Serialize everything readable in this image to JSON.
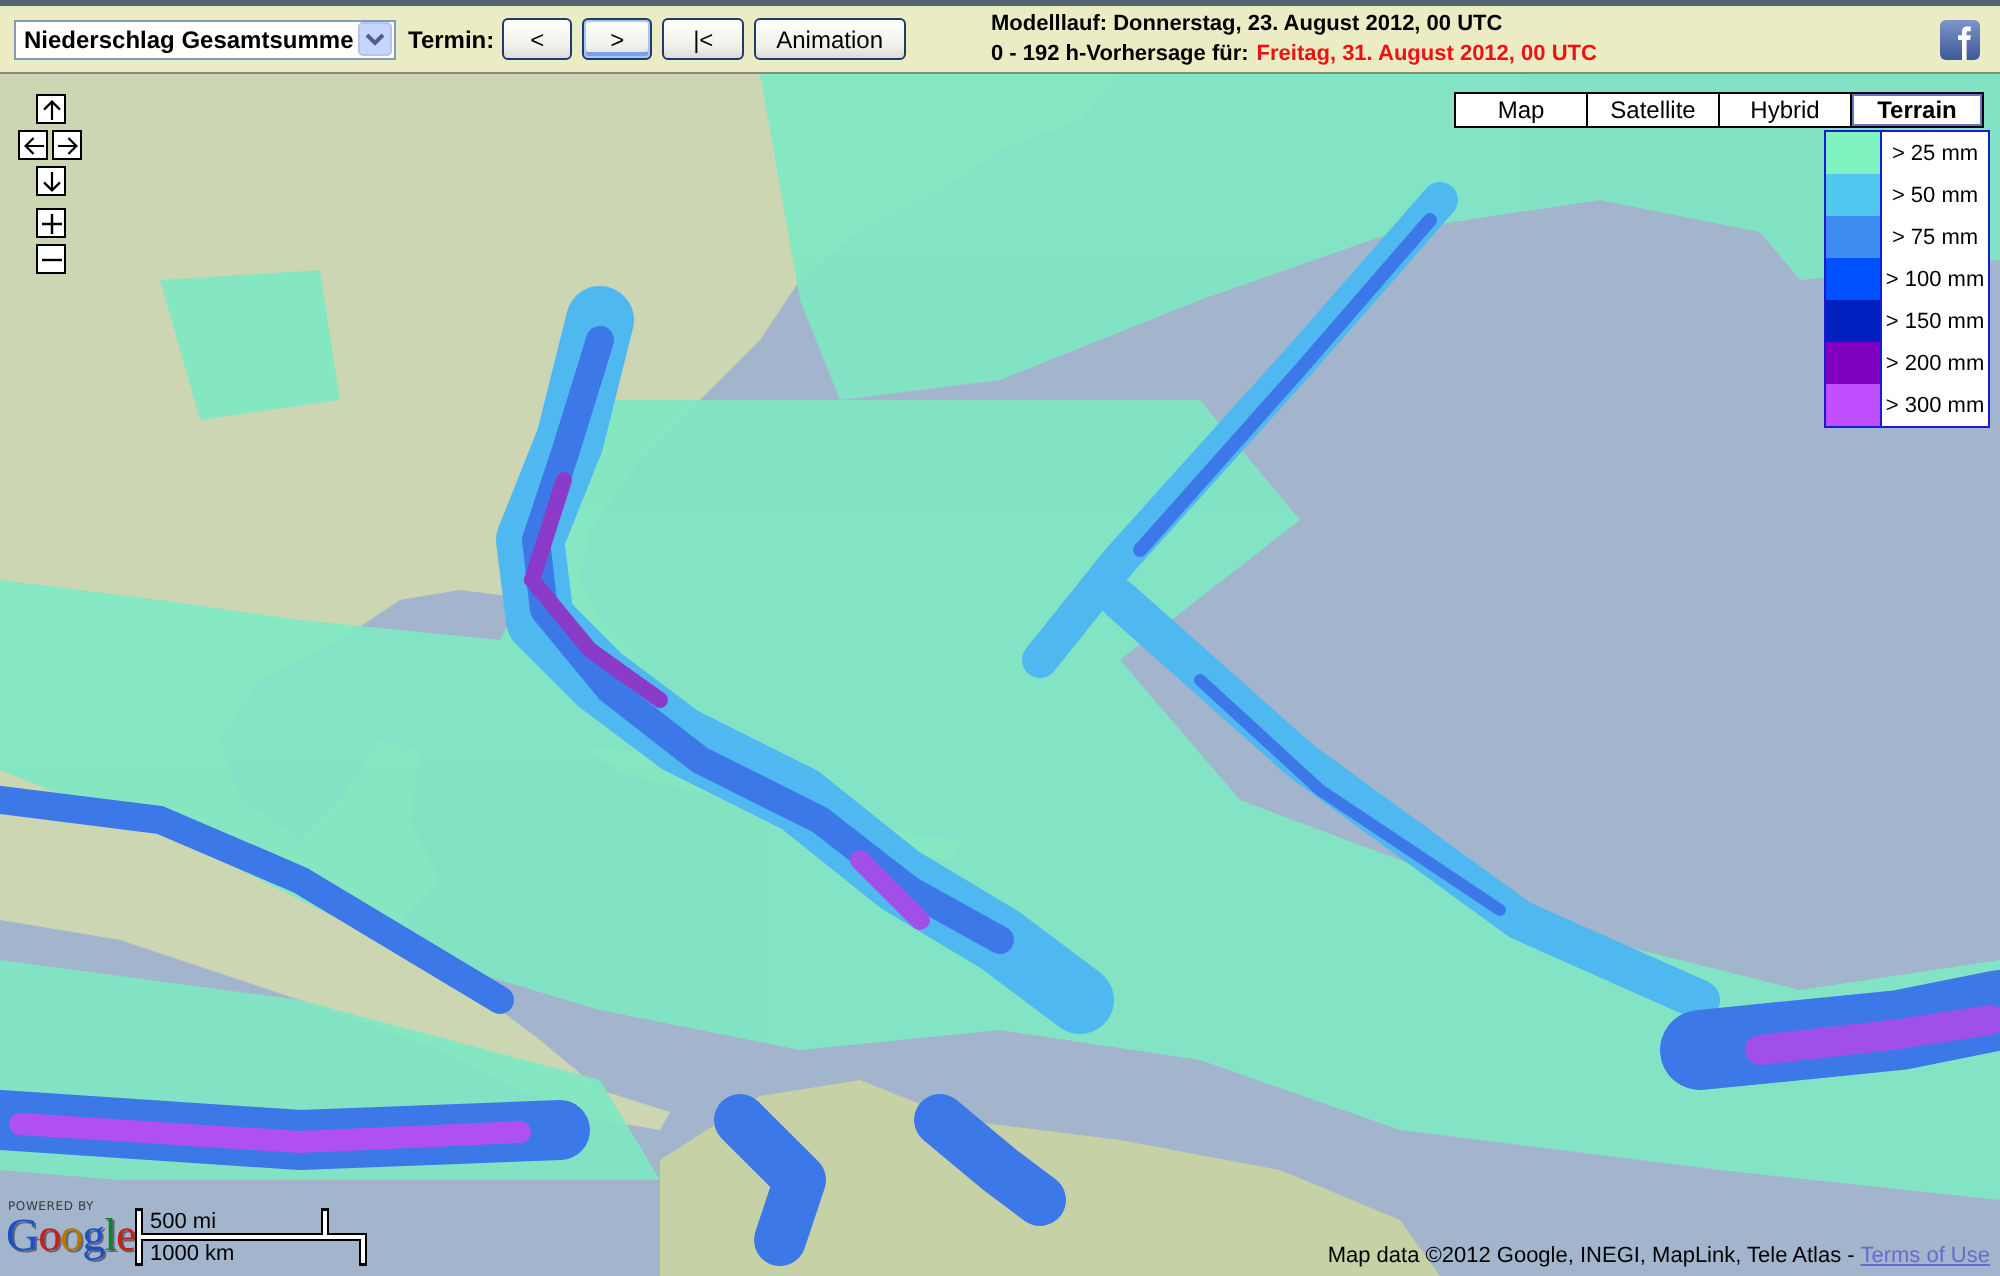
{
  "toolbar": {
    "product_select": {
      "value": "Niederschlag Gesamtsumme"
    },
    "termin_label": "Termin:",
    "buttons": [
      {
        "label": "<",
        "highlighted": false
      },
      {
        "label": ">",
        "highlighted": true
      },
      {
        "label": "|<",
        "highlighted": false
      },
      {
        "label": "Animation",
        "highlighted": false
      }
    ]
  },
  "model_run": {
    "text": "Modelllauf: Donnerstag, 23. August 2012, 00 UTC",
    "forecast_label": "0 - 192 h-Vorhersage für:",
    "forecast_date": "Freitag, 31. August 2012, 00 UTC"
  },
  "map": {
    "type_buttons": [
      {
        "label": "Map",
        "selected": false
      },
      {
        "label": "Satellite",
        "selected": false
      },
      {
        "label": "Hybrid",
        "selected": false
      },
      {
        "label": "Terrain",
        "selected": true
      }
    ],
    "legend": [
      {
        "label": "> 25 mm",
        "color": "#80f4c0"
      },
      {
        "label": "> 50 mm",
        "color": "#50c8f0"
      },
      {
        "label": "> 75 mm",
        "color": "#3c8cf0"
      },
      {
        "label": "> 100 mm",
        "color": "#0050ff"
      },
      {
        "label": "> 150 mm",
        "color": "#0020c0"
      },
      {
        "label": "> 200 mm",
        "color": "#8000c0"
      },
      {
        "label": "> 300 mm",
        "color": "#c050ff"
      }
    ],
    "logo": {
      "caption": "POWERED BY",
      "text": "Google"
    },
    "scale": {
      "miles": "500 mi",
      "kilometers": "1000 km"
    },
    "attribution": {
      "text": "Map data ©2012 Google, INEGI, MapLink, Tele Atlas -",
      "link": "Terms of Use"
    }
  }
}
